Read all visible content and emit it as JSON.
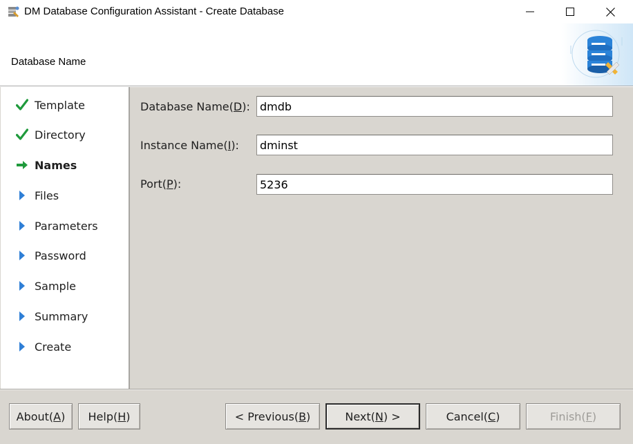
{
  "window": {
    "title": "DM Database Configuration Assistant - Create Database",
    "icon": "dm-app-icon",
    "controls": {
      "minimize": "minimize-icon",
      "maximize": "maximize-icon",
      "close": "close-icon"
    }
  },
  "header": {
    "step_title": "Database Name",
    "graphic": "database-settings-icon"
  },
  "nav": {
    "items": [
      {
        "label": "Template",
        "state": "done"
      },
      {
        "label": "Directory",
        "state": "done"
      },
      {
        "label": "Names",
        "state": "current"
      },
      {
        "label": "Files",
        "state": "pending"
      },
      {
        "label": "Parameters",
        "state": "pending"
      },
      {
        "label": "Password",
        "state": "pending"
      },
      {
        "label": "Sample",
        "state": "pending"
      },
      {
        "label": "Summary",
        "state": "pending"
      },
      {
        "label": "Create",
        "state": "pending"
      }
    ]
  },
  "form": {
    "db_name": {
      "label_pre": "Database Name(",
      "mnemonic": "D",
      "label_post": "):",
      "value": "dmdb"
    },
    "instance_name": {
      "label_pre": "Instance Name(",
      "mnemonic": "I",
      "label_post": "):",
      "value": "dminst"
    },
    "port": {
      "label_pre": "Port(",
      "mnemonic": "P",
      "label_post": "):",
      "value": "5236"
    }
  },
  "buttons": {
    "about": {
      "pre": "About(",
      "mn": "A",
      "post": ")"
    },
    "help": {
      "pre": "Help(",
      "mn": "H",
      "post": ")"
    },
    "previous": {
      "pre": "< Previous(",
      "mn": "B",
      "post": ")"
    },
    "next": {
      "pre": "Next(",
      "mn": "N",
      "post": ") >"
    },
    "cancel": {
      "pre": "Cancel(",
      "mn": "C",
      "post": ")"
    },
    "finish": {
      "pre": "Finish(",
      "mn": "F",
      "post": ")"
    }
  },
  "colors": {
    "check": "#1f9a3c",
    "arrow_current": "#1f9a3c",
    "arrow_pending": "#2f7fd6",
    "panel_bg": "#d9d6d0"
  }
}
